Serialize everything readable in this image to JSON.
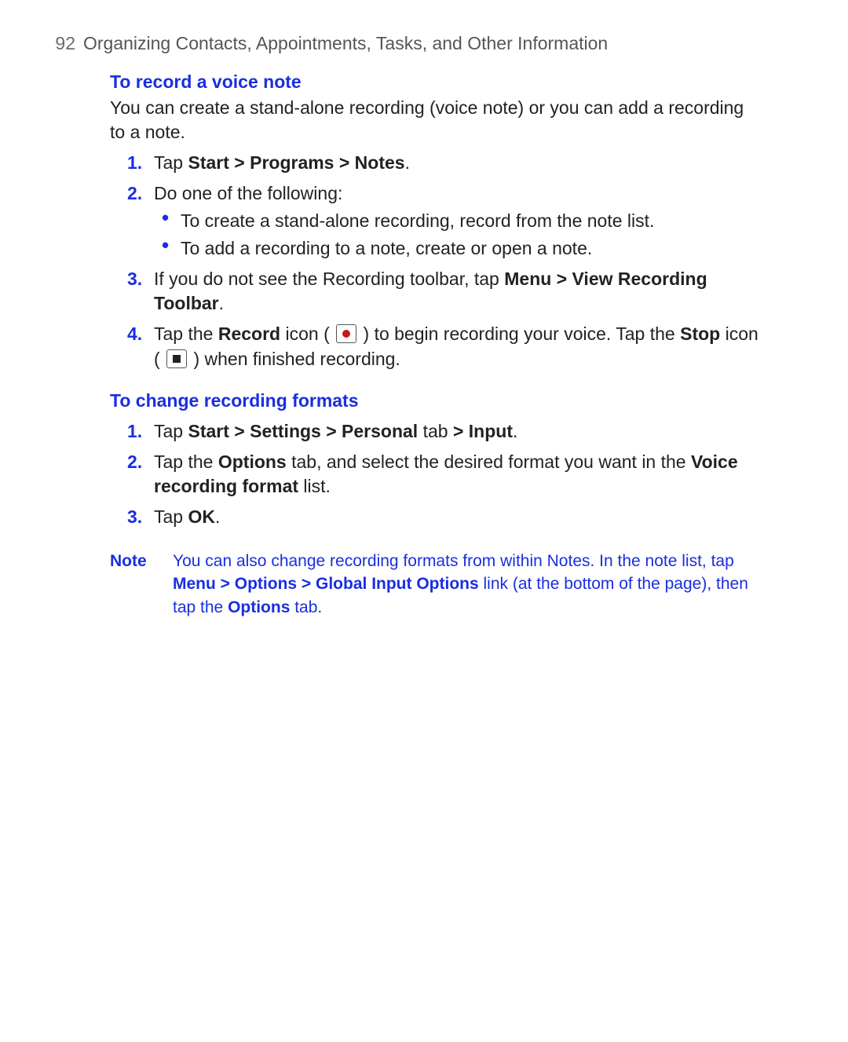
{
  "header": {
    "page_number": "92",
    "chapter_title": "Organizing Contacts, Appointments, Tasks, and Other Information"
  },
  "section1": {
    "heading": "To record a voice note",
    "lead": "You can create a stand-alone recording (voice note) or you can add a recording to a note.",
    "steps": {
      "s1": {
        "pre": "Tap ",
        "bold": "Start > Programs > Notes",
        "post": "."
      },
      "s2": {
        "text": "Do one of the following:",
        "bullets": {
          "b1": "To create a stand-alone recording, record from the note list.",
          "b2": "To add a recording to a note, create or open a note."
        }
      },
      "s3": {
        "pre": "If you do not see the Recording toolbar, tap ",
        "bold": "Menu > View Recording Toolbar",
        "post": "."
      },
      "s4": {
        "p1a": "Tap the ",
        "p1b": "Record",
        "p1c": " icon ( ",
        "p1d": " ) to begin recording your voice. Tap the ",
        "p2b": "Stop",
        "p2c": " icon ( ",
        "p2d": " ) when finished recording."
      }
    }
  },
  "section2": {
    "heading": "To change recording formats",
    "steps": {
      "s1": {
        "p1": "Tap ",
        "b1": "Start > Settings > Personal",
        "p2": " tab ",
        "b2": "> Input",
        "p3": "."
      },
      "s2": {
        "p1": "Tap the ",
        "b1": "Options",
        "p2": " tab, and select the desired format you want in the ",
        "b2": "Voice recording format",
        "p3": " list."
      },
      "s3": {
        "p1": "Tap ",
        "b1": "OK",
        "p2": "."
      }
    }
  },
  "note": {
    "label": "Note",
    "p1": "You can also change recording formats from within Notes. In the note list, tap ",
    "b1": "Menu > Options > Global Input Options",
    "p2": " link (at the bottom of the page), then tap the ",
    "b2": "Options",
    "p3": " tab."
  }
}
